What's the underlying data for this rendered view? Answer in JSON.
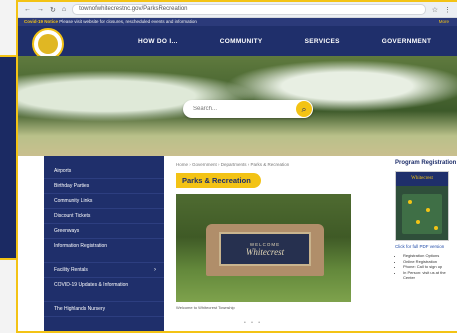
{
  "browser": {
    "url": "townofwhitecrestnc.gov/ParksRecreation",
    "nav_icons": [
      "back-arrow-icon",
      "forward-arrow-icon",
      "reload-icon",
      "home-icon"
    ]
  },
  "alert_bar": {
    "label": "Covid-19 Notice",
    "text": "Please visit website for closures, rescheduled events and information",
    "link": "More"
  },
  "nav": {
    "items": [
      "HOW DO I...",
      "COMMUNITY",
      "SERVICES",
      "GOVERNMENT"
    ]
  },
  "search": {
    "placeholder": "Search..."
  },
  "left_nav": {
    "items": [
      "Airports",
      "Birthday Parties",
      "Community Links",
      "Discount Tickets",
      "Greenways",
      "Information Registration",
      "Facility Rentals",
      "COVID-19 Updates & Information",
      "The Highlands Nursery"
    ]
  },
  "breadcrumb": "Home › Government › Departments › Parks & Recreation",
  "page_title": "Parks & Recreation",
  "photo": {
    "sign_welcome": "WELCOME",
    "sign_name": "Whitecrest",
    "caption": "Welcome to Whitecrest Township"
  },
  "pager": "• • •",
  "right_col": {
    "title": "Program Registration",
    "image_heading": "Whitecrest",
    "link": "Click for full PDF version",
    "list": [
      "Registration Options",
      "Online Registration",
      "Phone: Call to sign up",
      "In Person: visit us at the Center"
    ]
  },
  "side_rail_icons": [
    "id-card-icon",
    "check-circle-icon",
    "trash-icon",
    "clipboard-edit-icon",
    "person-running-icon",
    "megaphone-icon"
  ],
  "colors": {
    "navy": "#1f2f6b",
    "accent_yellow": "#f3c315"
  }
}
